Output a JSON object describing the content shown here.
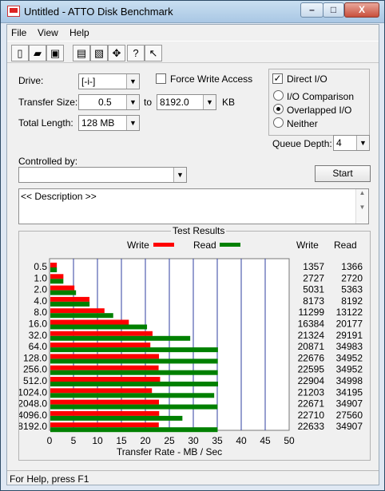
{
  "window": {
    "title": "Untitled - ATTO Disk Benchmark",
    "controls": {
      "minimize": "–",
      "maximize": "□",
      "close": "X"
    }
  },
  "menu": {
    "file": "File",
    "view": "View",
    "help": "Help"
  },
  "toolbar": {
    "icons": [
      "new-document-icon",
      "open-folder-icon",
      "save-icon",
      "print-icon",
      "print-preview-icon",
      "move-icon",
      "help-icon",
      "context-help-icon"
    ]
  },
  "form": {
    "drive_label": "Drive:",
    "drive_value": "[-i-]",
    "force_write_label": "Force Write Access",
    "force_write_checked": false,
    "direct_io_label": "Direct I/O",
    "direct_io_checked": true,
    "transfer_size_label": "Transfer Size:",
    "transfer_from": "0.5",
    "transfer_to_label": "to",
    "transfer_to": "8192.0",
    "transfer_unit": "KB",
    "total_length_label": "Total Length:",
    "total_length_value": "128 MB",
    "io_comparison_label": "I/O Comparison",
    "overlapped_io_label": "Overlapped I/O",
    "neither_label": "Neither",
    "selected_io_mode": "Overlapped I/O",
    "queue_depth_label": "Queue Depth:",
    "queue_depth_value": "4",
    "controlled_by_label": "Controlled by:",
    "controlled_by_value": "",
    "start_label": "Start",
    "description": "<< Description >>"
  },
  "results": {
    "title": "Test Results",
    "write_legend": "Write",
    "read_legend": "Read",
    "write_header": "Write",
    "read_header": "Read",
    "write_color": "#ff0000",
    "read_color": "#008000"
  },
  "chart_data": {
    "type": "bar",
    "categories": [
      "0.5",
      "1.0",
      "2.0",
      "4.0",
      "8.0",
      "16.0",
      "32.0",
      "64.0",
      "128.0",
      "256.0",
      "512.0",
      "1024.0",
      "2048.0",
      "4096.0",
      "8192.0"
    ],
    "series": [
      {
        "name": "Write",
        "values": [
          1357,
          2727,
          5031,
          8173,
          11299,
          16384,
          21324,
          20871,
          22676,
          22595,
          22904,
          21203,
          22671,
          22710,
          22633
        ]
      },
      {
        "name": "Read",
        "values": [
          1366,
          2720,
          5363,
          8192,
          13122,
          20177,
          29191,
          34983,
          34952,
          34952,
          34998,
          34195,
          34907,
          27560,
          34907
        ]
      }
    ],
    "xlabel": "Transfer Rate - MB / Sec",
    "ylabel": "",
    "xlim": [
      0,
      50
    ],
    "xticks": [
      "0",
      "5",
      "10",
      "15",
      "20",
      "25",
      "30",
      "35",
      "40",
      "45",
      "50"
    ],
    "grid": true
  },
  "status": {
    "text": "For Help, press F1"
  }
}
